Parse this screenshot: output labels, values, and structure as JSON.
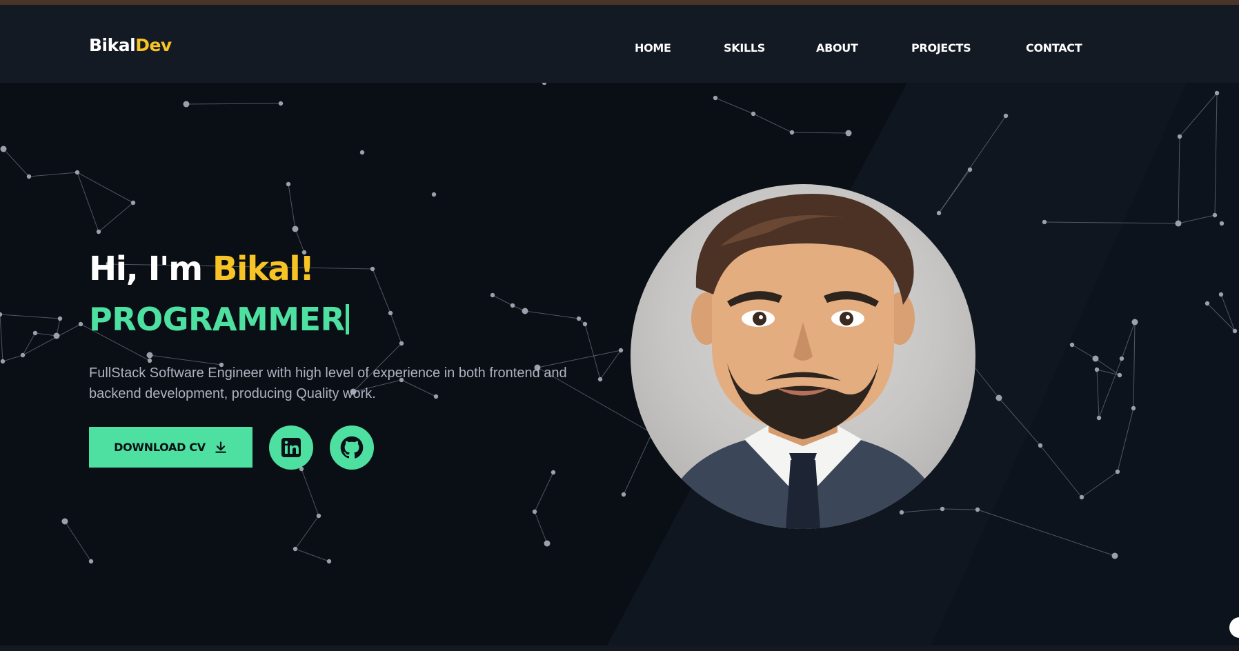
{
  "navbar": {
    "logo": {
      "part1": "Bikal",
      "part2": "Dev"
    },
    "links": [
      {
        "label": "HOME"
      },
      {
        "label": "SKILLS"
      },
      {
        "label": "ABOUT"
      },
      {
        "label": "PROJECTS"
      },
      {
        "label": "CONTACT"
      }
    ]
  },
  "hero": {
    "greeting_prefix": "Hi, I'm ",
    "greeting_name": "Bikal!",
    "role": "PROGRAMMER",
    "description": "FullStack Software Engineer with high level of experience in both frontend and backend development, producing Quality work.",
    "download_button": {
      "label": "DOWNLOAD CV",
      "icon": "download-icon"
    },
    "social_links": [
      {
        "icon": "linkedin-icon"
      },
      {
        "icon": "github-icon"
      }
    ]
  },
  "colors": {
    "background": "#0a0e15",
    "navbar": "#141a24",
    "accent_green": "#4ee0a0",
    "accent_yellow": "#f7c325",
    "text_white": "#ffffff",
    "text_muted": "#aeb4bf"
  }
}
